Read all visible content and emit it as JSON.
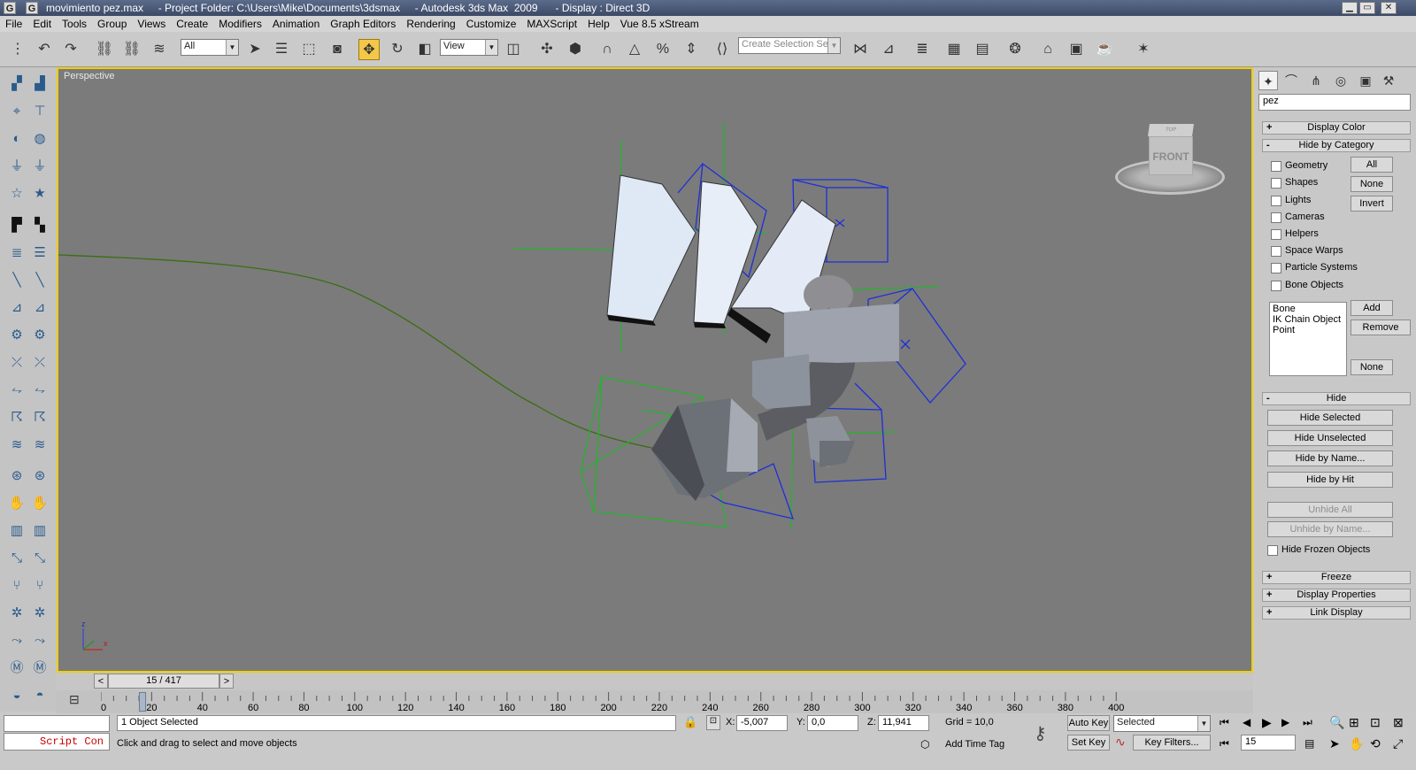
{
  "window": {
    "title": "movimiento pez.max     - Project Folder: C:\\Users\\Mike\\Documents\\3dsmax     - Autodesk 3ds Max  2009      - Display : Direct 3D",
    "logo_text": "G"
  },
  "menu": [
    "File",
    "Edit",
    "Tools",
    "Group",
    "Views",
    "Create",
    "Modifiers",
    "Animation",
    "Graph Editors",
    "Rendering",
    "Customize",
    "MAXScript",
    "Help",
    "Vue 8.5 xStream"
  ],
  "toolbar": {
    "selection_filter": "All",
    "reference_coord": "View",
    "named_selection_placeholder": "Create Selection Set"
  },
  "viewport": {
    "label": "Perspective",
    "viewcube_label": "FRONT",
    "viewcube_top": "TOP",
    "axis_x": "x",
    "axis_z": "z"
  },
  "command_panel": {
    "name_field": "pez",
    "rollouts": {
      "display_color": "Display Color",
      "hide_by_category": "Hide by Category",
      "hide": "Hide",
      "freeze": "Freeze",
      "display_properties": "Display Properties",
      "link_display": "Link Display"
    },
    "categories": [
      "Geometry",
      "Shapes",
      "Lights",
      "Cameras",
      "Helpers",
      "Space Warps",
      "Particle Systems",
      "Bone Objects"
    ],
    "category_buttons": {
      "all": "All",
      "none": "None",
      "invert": "Invert"
    },
    "list_items": [
      "Bone",
      "IK Chain Object",
      "Point"
    ],
    "list_buttons": {
      "add": "Add",
      "remove": "Remove",
      "none": "None"
    },
    "hide_buttons": [
      "Hide Selected",
      "Hide Unselected",
      "Hide by Name...",
      "Hide by Hit"
    ],
    "unhide_buttons": [
      "Unhide All",
      "Unhide by Name..."
    ],
    "hide_frozen": "Hide Frozen Objects"
  },
  "timeline": {
    "slider_text": "15 / 417",
    "prev": "<",
    "next": ">",
    "ticks": [
      "0",
      "20",
      "40",
      "60",
      "80",
      "100",
      "120",
      "140",
      "160",
      "180",
      "200",
      "220",
      "240",
      "260",
      "280",
      "300",
      "320",
      "340",
      "360",
      "380",
      "400"
    ],
    "current_frame_fraction": 0.036
  },
  "status": {
    "selection": "1 Object Selected",
    "prompt": "Click and drag to select and move objects",
    "script_label": "Script Con",
    "x_label": "X:",
    "x_value": "-5,007",
    "y_label": "Y:",
    "y_value": "0,0",
    "z_label": "Z:",
    "z_value": "11,941",
    "grid": "Grid = 10,0",
    "add_time_tag": "Add Time Tag",
    "auto_key": "Auto Key",
    "set_key": "Set Key",
    "key_mode": "Selected",
    "key_filters": "Key Filters...",
    "frame": "15"
  },
  "colors": {
    "viewport_bg": "#7b7b7b",
    "active_border": "#f0d000",
    "blue_wire": "#1d2fd8",
    "green_wire": "#24b42c",
    "path_green": "#3a6e12"
  }
}
